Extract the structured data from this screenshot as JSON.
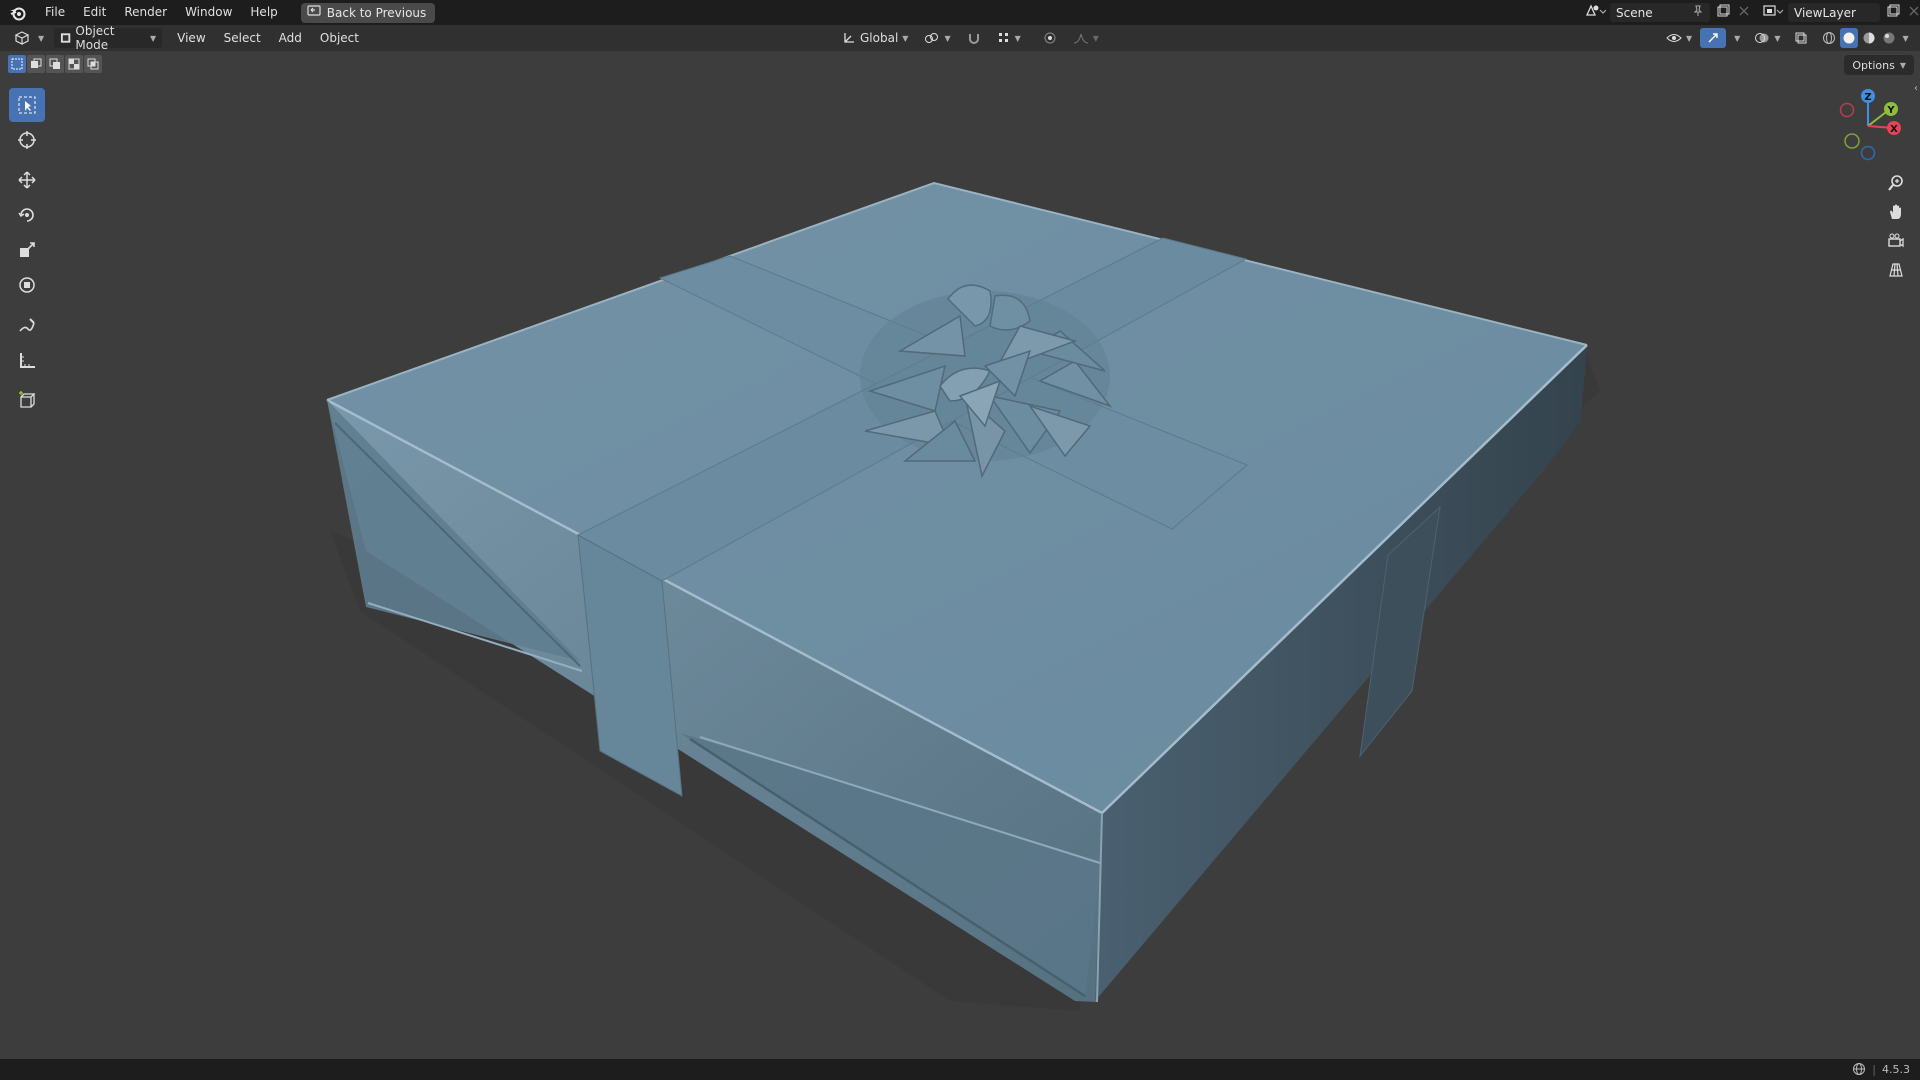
{
  "topbar": {
    "menus": [
      "File",
      "Edit",
      "Render",
      "Window",
      "Help"
    ],
    "back_label": "Back to Previous",
    "scene_label": "Scene",
    "viewlayer_label": "ViewLayer"
  },
  "viewport_header": {
    "mode_label": "Object Mode",
    "menus": [
      "View",
      "Select",
      "Add",
      "Object"
    ],
    "transform_orientation": "Global"
  },
  "viewport": {
    "options_label": "Options",
    "gizmo_axes": [
      "Z",
      "Y",
      "X"
    ]
  },
  "toolbar": {
    "tools": [
      "select-box",
      "cursor",
      "move",
      "rotate",
      "scale",
      "transform",
      "annotate",
      "measure",
      "add-cube"
    ],
    "active_tool": "select-box"
  },
  "statusbar": {
    "version": "4.5.3"
  },
  "colors": {
    "accent": "#4772b3",
    "model": "#6a8da1",
    "background": "#3d3d3d",
    "axis_x": "#e54457",
    "axis_y": "#8fbe3a",
    "axis_z": "#3f8fe5"
  }
}
